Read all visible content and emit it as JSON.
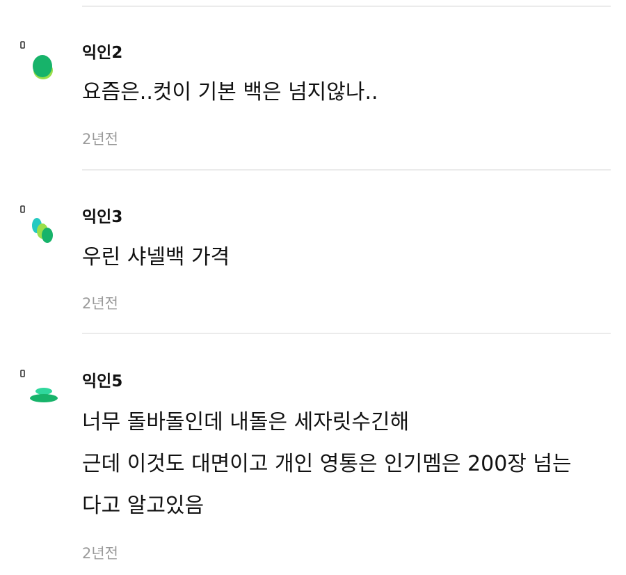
{
  "comments": [
    {
      "author": "익인2",
      "lines": [
        "요즘은..컷이 기본 백은 넘지않나.."
      ],
      "time": "2년전"
    },
    {
      "author": "익인3",
      "lines": [
        "우린 샤넬백 가격"
      ],
      "time": "2년전"
    },
    {
      "author": "익인5",
      "lines": [
        "너무 돌바돌인데 내돌은 세자릿수긴해",
        "근데 이것도 대면이고 개인 영통은 인기멤은 200장 넘는",
        "다고 알고있음"
      ],
      "time": "2년전"
    }
  ],
  "colors": {
    "divider": "#ebebeb",
    "time_text": "#9a9a9a",
    "avatar_green": "#17b36a",
    "avatar_lime": "#9adf4b",
    "avatar_teal": "#25c9c1",
    "avatar_mint": "#2fd79c"
  },
  "icons": [
    "avatar-blob-icon",
    "avatar-triple-blob-icon",
    "avatar-stack-icon",
    "bookmark-marker-icon"
  ]
}
